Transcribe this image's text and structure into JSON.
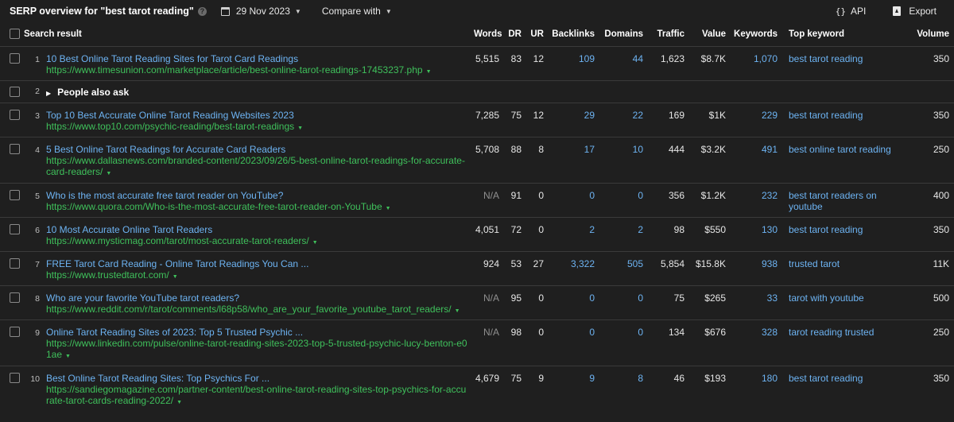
{
  "header": {
    "title": "SERP overview for \"best tarot reading\"",
    "date": "29 Nov 2023",
    "compare_label": "Compare with",
    "api_label": "API",
    "export_label": "Export"
  },
  "columns": {
    "search_result": "Search result",
    "words": "Words",
    "dr": "DR",
    "ur": "UR",
    "backlinks": "Backlinks",
    "domains": "Domains",
    "traffic": "Traffic",
    "value": "Value",
    "keywords": "Keywords",
    "top_keyword": "Top keyword",
    "volume": "Volume"
  },
  "rows": [
    {
      "num": "1",
      "title": "10 Best Online Tarot Reading Sites for Tarot Card Readings",
      "url": "https://www.timesunion.com/marketplace/article/best-online-tarot-readings-17453237.php",
      "words": "5,515",
      "dr": "83",
      "ur": "12",
      "backlinks": "109",
      "domains": "44",
      "traffic": "1,623",
      "value": "$8.7K",
      "keywords": "1,070",
      "top_keyword": "best tarot reading",
      "volume": "350"
    },
    {
      "num": "2",
      "paa": "People also ask"
    },
    {
      "num": "3",
      "title": "Top 10 Best Accurate Online Tarot Reading Websites 2023",
      "url": "https://www.top10.com/psychic-reading/best-tarot-readings",
      "words": "7,285",
      "dr": "75",
      "ur": "12",
      "backlinks": "29",
      "domains": "22",
      "traffic": "169",
      "value": "$1K",
      "keywords": "229",
      "top_keyword": "best tarot reading",
      "volume": "350"
    },
    {
      "num": "4",
      "title": "5 Best Online Tarot Readings for Accurate Card Readers",
      "url": "https://www.dallasnews.com/branded-content/2023/09/26/5-best-online-tarot-readings-for-accurate-card-readers/",
      "words": "5,708",
      "dr": "88",
      "ur": "8",
      "backlinks": "17",
      "domains": "10",
      "traffic": "444",
      "value": "$3.2K",
      "keywords": "491",
      "top_keyword": "best online tarot reading",
      "volume": "250"
    },
    {
      "num": "5",
      "title": "Who is the most accurate free tarot reader on YouTube?",
      "url": "https://www.quora.com/Who-is-the-most-accurate-free-tarot-reader-on-YouTube",
      "words": "N/A",
      "dr": "91",
      "ur": "0",
      "backlinks": "0",
      "domains": "0",
      "traffic": "356",
      "value": "$1.2K",
      "keywords": "232",
      "top_keyword": "best tarot readers on youtube",
      "volume": "400"
    },
    {
      "num": "6",
      "title": "10 Most Accurate Online Tarot Readers",
      "url": "https://www.mysticmag.com/tarot/most-accurate-tarot-readers/",
      "words": "4,051",
      "dr": "72",
      "ur": "0",
      "backlinks": "2",
      "domains": "2",
      "traffic": "98",
      "value": "$550",
      "keywords": "130",
      "top_keyword": "best tarot reading",
      "volume": "350"
    },
    {
      "num": "7",
      "title": "FREE Tarot Card Reading - Online Tarot Readings You Can ...",
      "url": "https://www.trustedtarot.com/",
      "words": "924",
      "dr": "53",
      "ur": "27",
      "backlinks": "3,322",
      "domains": "505",
      "traffic": "5,854",
      "value": "$15.8K",
      "keywords": "938",
      "top_keyword": "trusted tarot",
      "volume": "11K"
    },
    {
      "num": "8",
      "title": "Who are your favorite YouTube tarot readers?",
      "url": "https://www.reddit.com/r/tarot/comments/l68p58/who_are_your_favorite_youtube_tarot_readers/",
      "words": "N/A",
      "dr": "95",
      "ur": "0",
      "backlinks": "0",
      "domains": "0",
      "traffic": "75",
      "value": "$265",
      "keywords": "33",
      "top_keyword": "tarot with youtube",
      "volume": "500"
    },
    {
      "num": "9",
      "title": "Online Tarot Reading Sites of 2023: Top 5 Trusted Psychic ...",
      "url": "https://www.linkedin.com/pulse/online-tarot-reading-sites-2023-top-5-trusted-psychic-lucy-benton-e01ae",
      "words": "N/A",
      "dr": "98",
      "ur": "0",
      "backlinks": "0",
      "domains": "0",
      "traffic": "134",
      "value": "$676",
      "keywords": "328",
      "top_keyword": "tarot reading trusted",
      "volume": "250"
    },
    {
      "num": "10",
      "title": "Best Online Tarot Reading Sites: Top Psychics For ...",
      "url": "https://sandiegomagazine.com/partner-content/best-online-tarot-reading-sites-top-psychics-for-accurate-tarot-cards-reading-2022/",
      "words": "4,679",
      "dr": "75",
      "ur": "9",
      "backlinks": "9",
      "domains": "8",
      "traffic": "46",
      "value": "$193",
      "keywords": "180",
      "top_keyword": "best tarot reading",
      "volume": "350"
    }
  ]
}
